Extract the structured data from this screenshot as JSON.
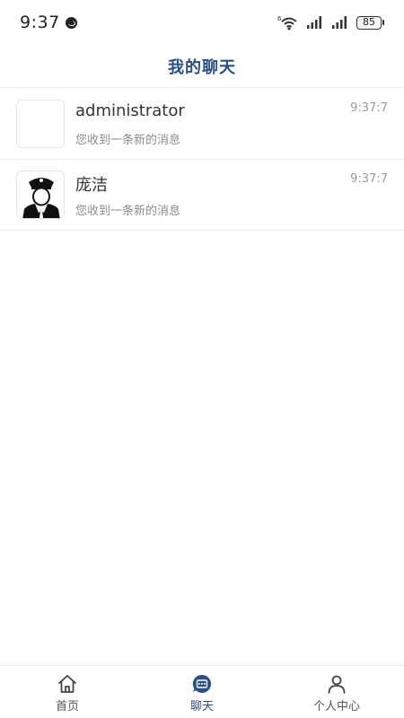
{
  "status_bar": {
    "time": "9:37",
    "battery": "85",
    "network_label": "6"
  },
  "header": {
    "title": "我的聊天"
  },
  "chats": [
    {
      "name": "administrator",
      "preview": "您收到一条新的消息",
      "time": "9:37:7",
      "avatar": "blank-avatar"
    },
    {
      "name": "庞洁",
      "preview": "您收到一条新的消息",
      "time": "9:37:7",
      "avatar": "police-officer-avatar"
    }
  ],
  "tab_bar": {
    "tabs": [
      {
        "label": "首页",
        "icon": "home-icon",
        "active": false
      },
      {
        "label": "聊天",
        "icon": "chat-icon",
        "active": true
      },
      {
        "label": "个人中心",
        "icon": "person-icon",
        "active": false
      }
    ]
  },
  "colors": {
    "accent": "#2a4f86",
    "muted_text": "#8c8c8c",
    "divider": "#ececec"
  }
}
